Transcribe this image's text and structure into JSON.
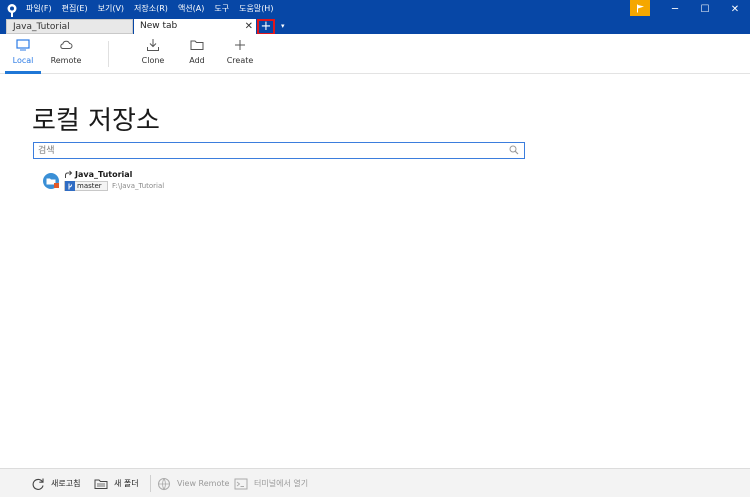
{
  "titlebar": {
    "menu": [
      "파일(F)",
      "편집(E)",
      "보기(V)",
      "저장소(R)",
      "액션(A)",
      "도구",
      "도움말(H)"
    ],
    "accent_color": "#0747a6",
    "flag_color": "#f5a700",
    "window_controls": [
      "─",
      "☐",
      "✕"
    ]
  },
  "tabs": [
    {
      "label": "Java_Tutorial"
    },
    {
      "label": "New tab",
      "close": "✕"
    }
  ],
  "new_tab": {
    "symbol": "+",
    "dropdown": "▾"
  },
  "toolbar": {
    "local": "Local",
    "remote": "Remote",
    "clone": "Clone",
    "add": "Add",
    "create": "Create"
  },
  "main": {
    "title": "로컬 저장소",
    "search_placeholder": "검색"
  },
  "repos": [
    {
      "name": "Java_Tutorial",
      "branch": "master",
      "path": "F:\\Java_Tutorial"
    }
  ],
  "bottombar": {
    "refresh": "새로고침",
    "new_folder": "새 폴더",
    "view_remote": "View Remote",
    "open_terminal": "터미널에서 열기"
  }
}
